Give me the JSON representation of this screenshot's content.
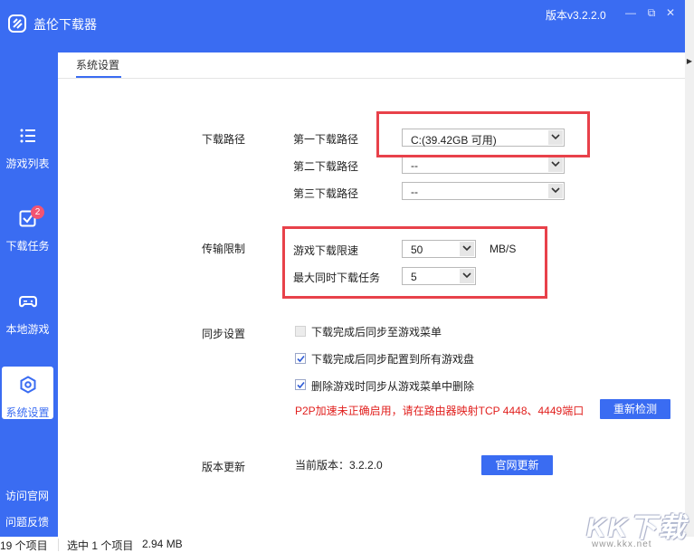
{
  "window": {
    "app_title": "盖伦下载器",
    "version_label": "版本v3.2.2.0",
    "minimize_glyph": "—",
    "maximize_glyph": "⧉",
    "close_glyph": "✕",
    "accent_color": "#3a6cf2"
  },
  "sidebar": {
    "items": [
      {
        "label": "游戏列表",
        "icon": "list-icon"
      },
      {
        "label": "下载任务",
        "icon": "checkbox-icon",
        "badge": "2"
      },
      {
        "label": "本地游戏",
        "icon": "gamepad-icon"
      },
      {
        "label": "系统设置",
        "icon": "settings-icon",
        "active": true
      }
    ],
    "links": {
      "official_site": "访问官网",
      "feedback": "问题反馈"
    }
  },
  "tabs": {
    "active": "系统设置"
  },
  "settings": {
    "download_path": {
      "section": "下载路径",
      "first_label": "第一下载路径",
      "first_value": "C:(39.42GB 可用)",
      "second_label": "第二下载路径",
      "second_value": "--",
      "third_label": "第三下载路径",
      "third_value": "--"
    },
    "transfer": {
      "section": "传输限制",
      "speed_label": "游戏下载限速",
      "speed_value": "50",
      "speed_unit": "MB/S",
      "max_tasks_label": "最大同时下载任务",
      "max_tasks_value": "5"
    },
    "sync": {
      "section": "同步设置",
      "options": [
        {
          "label": "下载完成后同步至游戏菜单",
          "checked": false,
          "disabled": true
        },
        {
          "label": "下载完成后同步配置到所有游戏盘",
          "checked": true,
          "disabled": false
        },
        {
          "label": "删除游戏时同步从游戏菜单中删除",
          "checked": true,
          "disabled": false
        }
      ],
      "warning": "P2P加速未正确启用，请在路由器映射TCP 4448、4449端口",
      "recheck_button": "重新检测",
      "warning_color": "#e1201e"
    },
    "update": {
      "section": "版本更新",
      "current_version": "当前版本：3.2.2.0",
      "update_button": "官网更新"
    }
  },
  "statusbar": {
    "item_count": "19 个项目",
    "selected": "选中 1 个项目",
    "size": "2.94 MB"
  },
  "watermark": {
    "text": "KK下载",
    "url": "www.kkx.net"
  }
}
